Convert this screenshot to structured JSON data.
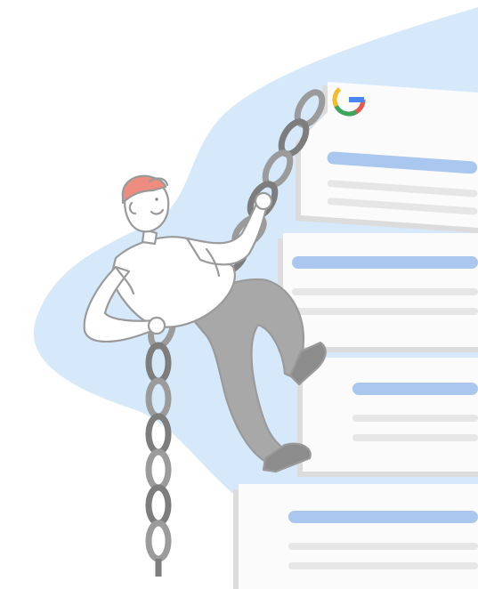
{
  "illustration": {
    "description_free": true,
    "logo_text": "G",
    "colors": {
      "blob": "#d6e9fb",
      "card": "#fbfbfb",
      "card_shadow": "#dcdcdc",
      "bar_blue": "#aac8ef",
      "bar_gray": "#e6e6e6",
      "chain": "#9b9b9b",
      "chain_dark": "#7d7d7d",
      "skin": "#ffffff",
      "outline": "#9a9a9a",
      "pants": "#a8a8a8",
      "shoes": "#8c8c8c",
      "cap": "#ee8c80",
      "logo_blue": "#4a86f0",
      "logo_red": "#e8584a",
      "logo_yellow": "#f4bb2e",
      "logo_green": "#3ea65a"
    },
    "icons": [
      "google-g-logo",
      "climber-person",
      "chain-links",
      "result-cards-stack"
    ]
  }
}
